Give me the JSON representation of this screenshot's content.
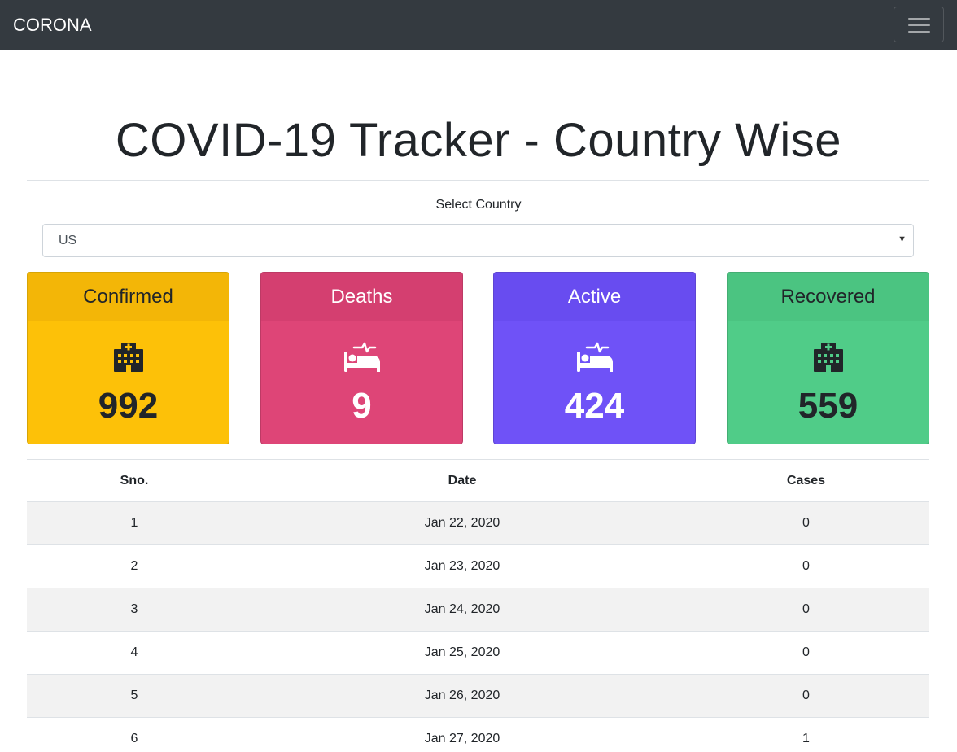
{
  "navbar": {
    "brand": "CORONA",
    "toggler_icon": "hamburger-menu-icon"
  },
  "page": {
    "title": "COVID-19 Tracker - Country Wise"
  },
  "country_select": {
    "label": "Select Country",
    "value": "US"
  },
  "cards": [
    {
      "id": "confirmed",
      "label": "Confirmed",
      "value": "992",
      "icon": "hospital-icon",
      "bg": "#fdc108",
      "head_bg": "#f3b607",
      "text_color": "#212529"
    },
    {
      "id": "deaths",
      "label": "Deaths",
      "value": "9",
      "icon": "procedures-bed-icon",
      "bg": "#de4577",
      "head_bg": "#d43f70",
      "text_color": "#ffffff"
    },
    {
      "id": "active",
      "label": "Active",
      "value": "424",
      "icon": "procedures-bed-icon",
      "bg": "#6f52f7",
      "head_bg": "#684cf0",
      "text_color": "#ffffff"
    },
    {
      "id": "recovered",
      "label": "Recovered",
      "value": "559",
      "icon": "hospital-icon",
      "bg": "#50cc88",
      "head_bg": "#4bc481",
      "text_color": "#212529"
    }
  ],
  "table": {
    "columns": [
      "Sno.",
      "Date",
      "Cases"
    ],
    "rows": [
      {
        "sno": "1",
        "date": "Jan 22, 2020",
        "cases": "0"
      },
      {
        "sno": "2",
        "date": "Jan 23, 2020",
        "cases": "0"
      },
      {
        "sno": "3",
        "date": "Jan 24, 2020",
        "cases": "0"
      },
      {
        "sno": "4",
        "date": "Jan 25, 2020",
        "cases": "0"
      },
      {
        "sno": "5",
        "date": "Jan 26, 2020",
        "cases": "0"
      },
      {
        "sno": "6",
        "date": "Jan 27, 2020",
        "cases": "1"
      }
    ]
  }
}
